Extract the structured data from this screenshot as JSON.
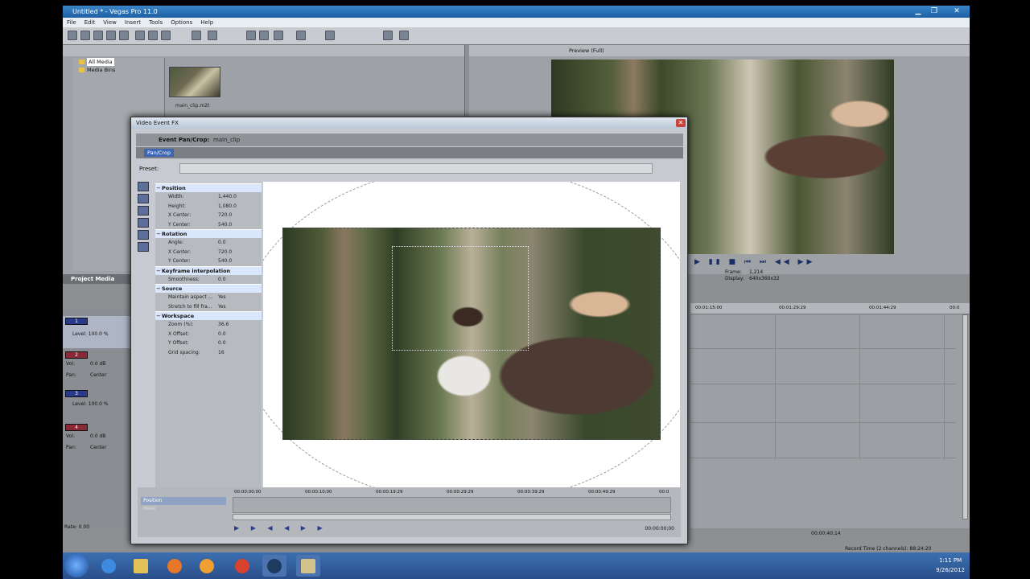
{
  "window": {
    "title": "Untitled * - Vegas Pro 11.0",
    "minimize": "▁",
    "maximize": "❐",
    "close": "✕"
  },
  "menu": [
    "File",
    "Edit",
    "View",
    "Insert",
    "Tools",
    "Options",
    "Help"
  ],
  "explorer": {
    "tree": [
      {
        "label": "All Media",
        "selected": true
      },
      {
        "label": "Media Bins",
        "selected": false
      }
    ],
    "media_file": "main_clip.m2t"
  },
  "preview": {
    "mode": "Preview (Full)",
    "frame_label": "Frame:",
    "frame_value": "1,214",
    "display_label": "Display:",
    "display_value": "640x360x32",
    "transport": "▶ ▮▮ ■ ⏮ ⏭ ◀◀ ▶▶"
  },
  "project_media_tab": "Project Media",
  "tracks": [
    {
      "num": "1",
      "type": "video",
      "rows": [
        {
          "label": "Level: 100.0 %",
          "value": ""
        }
      ]
    },
    {
      "num": "2",
      "type": "audio",
      "rows": [
        {
          "label": "Vol:",
          "value": "0.0 dB"
        },
        {
          "label": "Pan:",
          "value": "Center"
        }
      ]
    },
    {
      "num": "3",
      "type": "video",
      "rows": [
        {
          "label": "Level: 100.0 %",
          "value": ""
        }
      ]
    },
    {
      "num": "4",
      "type": "audio",
      "rows": [
        {
          "label": "Vol:",
          "value": "0.0 dB"
        },
        {
          "label": "Pan:",
          "value": "Center"
        }
      ]
    }
  ],
  "rate": "Rate: 0.00",
  "timeline_ruler": [
    "00:01:15:00",
    "00:01:29:29",
    "00:01:44:29",
    "00:0"
  ],
  "status": {
    "position": "00:00:40;14",
    "record_time": "Record Time (2 channels): 88:24:20"
  },
  "fx_dialog": {
    "title": "Video Event FX",
    "header_title": "Event Pan/Crop:",
    "header_clip": "main_clip",
    "tab": "Pan/Crop",
    "preset_label": "Preset:",
    "sections": [
      {
        "name": "Position",
        "props": [
          {
            "label": "Width:",
            "value": "1,440.0"
          },
          {
            "label": "Height:",
            "value": "1,080.0"
          },
          {
            "label": "X Center:",
            "value": "720.0"
          },
          {
            "label": "Y Center:",
            "value": "540.0"
          }
        ]
      },
      {
        "name": "Rotation",
        "props": [
          {
            "label": "Angle:",
            "value": "0.0"
          },
          {
            "label": "X Center:",
            "value": "720.0"
          },
          {
            "label": "Y Center:",
            "value": "540.0"
          }
        ]
      },
      {
        "name": "Keyframe interpolation",
        "props": [
          {
            "label": "Smoothness:",
            "value": "0.0"
          }
        ]
      },
      {
        "name": "Source",
        "props": [
          {
            "label": "Maintain aspect ...",
            "value": "Yes"
          },
          {
            "label": "Stretch to fill fra...",
            "value": "Yes"
          }
        ]
      },
      {
        "name": "Workspace",
        "props": [
          {
            "label": "Zoom (%):",
            "value": "36.6"
          },
          {
            "label": "X Offset:",
            "value": "0.0"
          },
          {
            "label": "Y Offset:",
            "value": "0.0"
          },
          {
            "label": "Grid spacing:",
            "value": "16"
          }
        ]
      }
    ],
    "timeline_ruler": [
      "00:00:00:00",
      "00:00:10:00",
      "00:00:19:29",
      "00:00:29:29",
      "00:00:39:29",
      "00:00:49:29",
      "00:0"
    ],
    "timeline_tracks": [
      "Position",
      "Mask"
    ],
    "controls": "▶ ▶ ◀ ◀ ▶ ▶",
    "time": "00:00:00;00"
  },
  "clock": {
    "time": "1:11 PM",
    "date": "9/26/2012"
  }
}
